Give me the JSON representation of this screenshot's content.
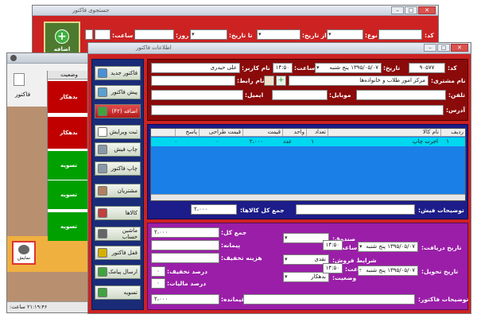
{
  "back_window": {
    "title": "جستجوی فاکتور",
    "labels": {
      "code": "کد:",
      "type": "نوع:",
      "from_date": "از تاریخ:",
      "to_date": "تا تاریخ:",
      "day": "روز:",
      "time": "ساعت:",
      "add_button": "اضافه"
    }
  },
  "left_window": {
    "title_text": "فاکتور",
    "grid_header": "وضعیت",
    "rows": [
      {
        "status": "بدهکار",
        "color": "#c00000"
      },
      {
        "status": "بدهکار",
        "color": "#c00000"
      },
      {
        "status": "تسویه",
        "color": "#00a000"
      },
      {
        "status": "تسویه",
        "color": "#00a000"
      },
      {
        "status": "تسویه",
        "color": "#00a000"
      }
    ],
    "bottom_button": "نمایش",
    "status_time_label": "ساعت:",
    "status_time_value": "۲۱:۱۹:۴۶",
    "status_date": "۰۳۰۳"
  },
  "main_window": {
    "title": "اطلاعات فاکتور",
    "sidebar": [
      {
        "label": "فاکتور جدید",
        "icon_color": "#4a8fd8"
      },
      {
        "label": "پیش فاکتور",
        "icon_color": "#5aa0d0"
      },
      {
        "label": "اضافه (F۲)",
        "icon_color": "#3fa33f"
      },
      {
        "label": "ثبت ویرایش",
        "icon_color": "#ffffff"
      },
      {
        "label": "چاپ فیش",
        "icon_color": "#8899aa"
      },
      {
        "label": "چاپ فاکتور",
        "icon_color": "#8899aa"
      },
      {
        "label": "مشتریان",
        "icon_color": "#b08060"
      },
      {
        "label": "کالاها",
        "icon_color": "#c04040"
      },
      {
        "label": "ماشین حساب",
        "icon_color": "#666666"
      },
      {
        "label": "قفل فاکتور",
        "icon_color": "#d6b000"
      },
      {
        "label": "ارسال پیامک",
        "icon_color": "#3fa33f"
      },
      {
        "label": "تسویه",
        "icon_color": "#3fa33f"
      }
    ],
    "header": {
      "code_label": "کد:",
      "code_value": "۹۰۵۷۷",
      "date_label": "تاریخ:",
      "date_value": "۱۳۹۵/۰۵/۰۷ پنج شنبه",
      "time_label": "ساعت:",
      "time_value": "۱۴:۵۰",
      "user_label": "نام کاربر:",
      "user_value": "علی حیدری",
      "customer_label": "نام مشتری:",
      "customer_value": "مرکز امور طلاب و خانواده‌ها",
      "contact_label": "نام رابط:",
      "phone_label": "تلفن:",
      "mobile_label": "موبایل:",
      "email_label": "ایمیل:",
      "address_label": "آدرس:"
    },
    "grid": {
      "columns": [
        "ردیف",
        "نام کالا",
        "تعداد",
        "واحد",
        "قیمت",
        "قیمت طراحی",
        "پاسخ"
      ],
      "rows": [
        {
          "row": "۱",
          "name": "اجرت چاپ",
          "qty": "۱",
          "unit": "عدد",
          "price": "۲،۰۰۰",
          "design": "۰",
          "answer": "۰"
        }
      ],
      "notes_label": "توضیحات فیش:",
      "total_label": "جمع کل کالاها:",
      "total_value": "۲،۰۰۰"
    },
    "footer": {
      "sum_label": "جمع کل:",
      "sum_value": "۲،۰۰۰",
      "advance_label": "پیمانه:",
      "discount_cost_label": "هزینه تخفیف:",
      "discount_pct_label": "درصد تخفیف:",
      "discount_pct_value": "۰",
      "tax_pct_label": "درصد مالیات:",
      "tax_pct_value": "۰",
      "remaining_label": "باقیمانده:",
      "remaining_value": "۲،۰۰۰",
      "fund_label": "صندوق:",
      "terms_label": "شرایط فروش:",
      "terms_value": "نقدی",
      "status_label": "وضعیت:",
      "status_value": "بدهکار",
      "receive_date_label": "تاریخ دریافت:",
      "receive_date_value": "۱۳۹۵/۰۵/۰۷ پنج شنبه",
      "receive_time_label": "ساعت:",
      "receive_time_value": "۱۴:۵۰",
      "delivery_date_label": "تاریخ تحویل:",
      "delivery_date_value": "۱۳۹۵/۰۵/۰۷ پنج شنبه",
      "delivery_time_label": "ساعت:",
      "delivery_time_value": "۱۴:۵۰",
      "invoice_notes_label": "توضیحات فاکتور:"
    }
  }
}
